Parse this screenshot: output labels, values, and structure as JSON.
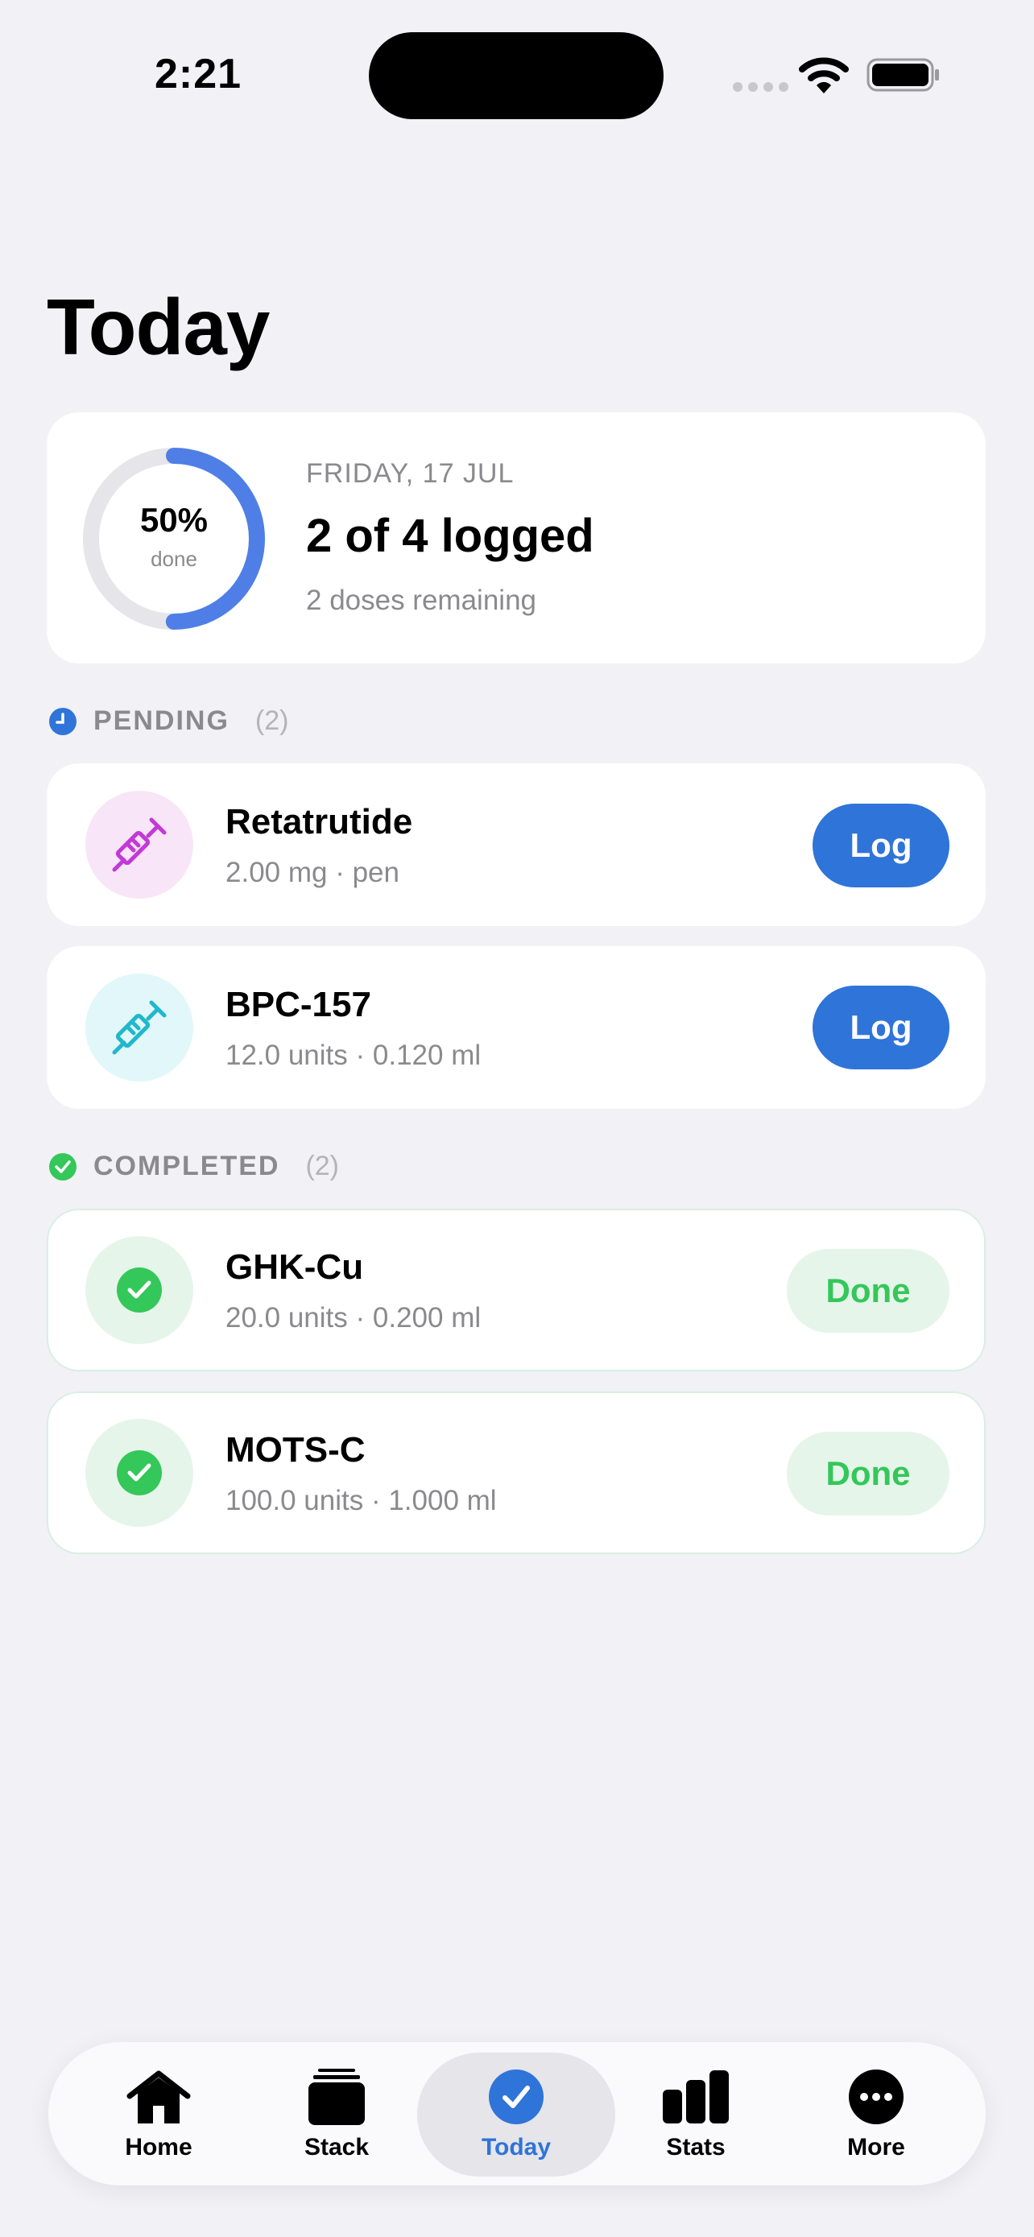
{
  "status_bar": {
    "time": "2:21"
  },
  "header": {
    "title": "Today"
  },
  "summary": {
    "percent_label": "50%",
    "percent_sub": "done",
    "progress_fraction": 0.5,
    "date": "FRIDAY, 17 JUL",
    "logged": "2 of 4 logged",
    "remaining": "2 doses remaining"
  },
  "pending": {
    "title": "PENDING",
    "count": "(2)",
    "items": [
      {
        "name": "Retatrutide",
        "detail": "2.00 mg · pen",
        "action": "Log",
        "icon": "syringe-icon",
        "color": "#c23ad6"
      },
      {
        "name": "BPC-157",
        "detail": "12.0 units · 0.120 ml",
        "action": "Log",
        "icon": "syringe-icon",
        "color": "#1fb8cc"
      }
    ]
  },
  "completed": {
    "title": "COMPLETED",
    "count": "(2)",
    "items": [
      {
        "name": "GHK-Cu",
        "detail": "20.0 units · 0.200 ml",
        "status": "Done",
        "icon": "check-circle-icon"
      },
      {
        "name": "MOTS-C",
        "detail": "100.0 units · 1.000 ml",
        "status": "Done",
        "icon": "check-circle-icon"
      }
    ]
  },
  "tabs": [
    {
      "label": "Home",
      "icon": "house-icon"
    },
    {
      "label": "Stack",
      "icon": "stack-icon"
    },
    {
      "label": "Today",
      "icon": "checkmark-circle-icon",
      "active": true
    },
    {
      "label": "Stats",
      "icon": "bar-chart-icon"
    },
    {
      "label": "More",
      "icon": "ellipsis-circle-icon"
    }
  ],
  "colors": {
    "accent": "#2f74d8",
    "success": "#34c759",
    "background": "#f1f1f6"
  }
}
